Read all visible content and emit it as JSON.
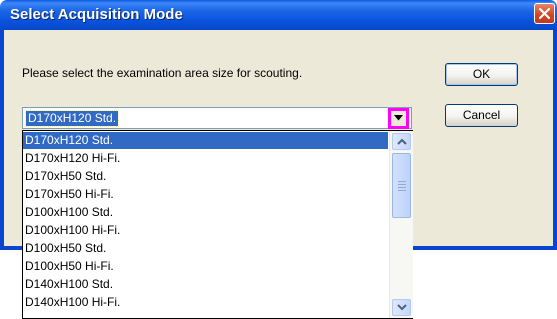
{
  "dialog": {
    "title": "Select Acquisition Mode",
    "prompt": "Please select the examination area size for scouting.",
    "ok_label": "OK",
    "cancel_label": "Cancel",
    "close_icon": "close-icon"
  },
  "combo": {
    "selected_value": "D170xH120 Std.",
    "arrow_icon": "chevron-down-icon",
    "options": [
      "D170xH120 Std.",
      "D170xH120 Hi-Fi.",
      "D170xH50 Std.",
      "D170xH50 Hi-Fi.",
      "D100xH100 Std.",
      "D100xH100 Hi-Fi.",
      "D100xH50 Std.",
      "D100xH50 Hi-Fi.",
      "D140xH100 Std.",
      "D140xH100 Hi-Fi."
    ]
  },
  "colors": {
    "title_bar": "#0953dd",
    "selection": "#316ac5",
    "highlight_box": "#ff00ff"
  }
}
